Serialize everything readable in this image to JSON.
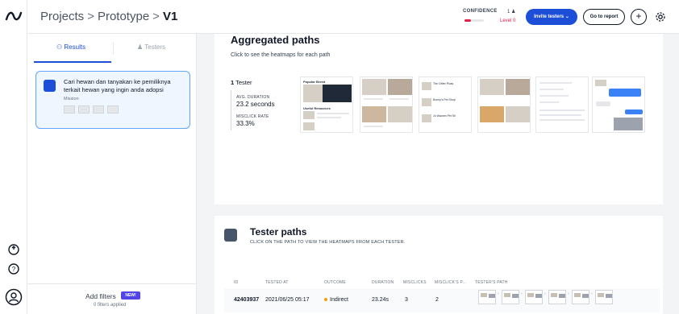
{
  "breadcrumb": {
    "root": "Projects",
    "project": "Prototype",
    "current": "V1",
    "separator": ">"
  },
  "confidence": {
    "label": "CONFIDENCE",
    "count": "1",
    "level": "Level 0"
  },
  "header": {
    "invite_label": "Invite testers",
    "report_label": "Go to report",
    "add_label": "+"
  },
  "tabs": {
    "results": "Results",
    "testers": "Testers"
  },
  "task": {
    "text": "Cari hewan dan tanyakan ke pemiliknya terkait hewan yang ingin anda adopsi",
    "type": "Mission"
  },
  "filters": {
    "label": "Add filters",
    "badge": "NEW!",
    "applied": "0 filters applied"
  },
  "aggregated": {
    "title": "Aggregated paths",
    "subtitle": "Click to see the heatmaps for each path",
    "testers_count": "1",
    "testers_word": "Tester",
    "avg_duration_label": "AVG. DURATION",
    "avg_duration_value": "23.2 seconds",
    "misclick_label": "MISCLICK RATE",
    "misclick_value": "33.3%",
    "shot1_title": "Popular Breed",
    "shot1_section": "Useful Resources",
    "shot3_items": [
      "The Other Pluss",
      "Bonny's Pet Shop",
      "Jo Waonm Pet Sh"
    ]
  },
  "tester_paths": {
    "title": "Tester paths",
    "subtitle": "CLICK ON THE PATH TO VIEW THE HEATMAPS FROM EACH TESTER.",
    "columns": [
      "ID",
      "TESTED AT",
      "OUTCOME",
      "DURATION",
      "MISCLICKS",
      "MISCLICK'S P...",
      "TESTER'S PATH"
    ],
    "row": {
      "id": "42403937",
      "tested_at": "2021/06/25 05:17",
      "outcome": "Indirect",
      "duration": "23.24s",
      "misclicks": "3",
      "misclick_p": "2"
    }
  },
  "colors": {
    "accent": "#1d4ed8",
    "danger": "#e11d48",
    "indirect": "#f59e0b"
  }
}
